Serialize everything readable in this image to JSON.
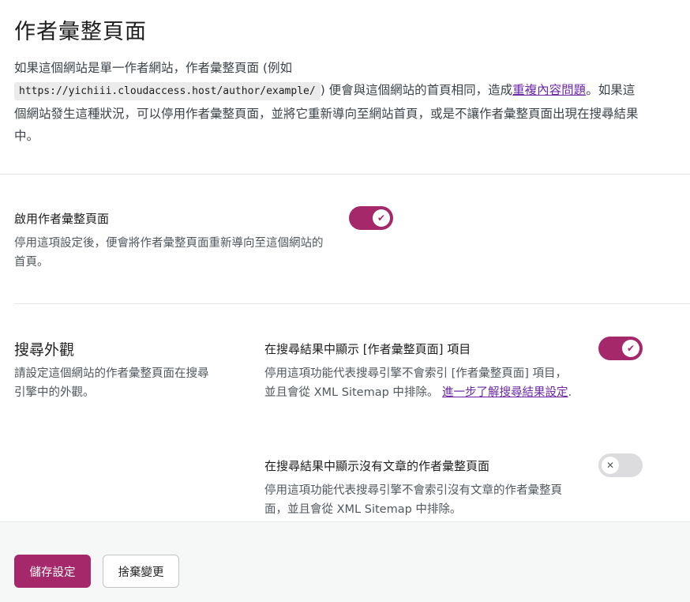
{
  "page": {
    "title": "作者彙整頁面"
  },
  "intro": {
    "text_before_code": "如果這個網站是單一作者網站，作者彙整頁面 (例如",
    "code": "https://yichiii.cloudaccess.host/author/example/",
    "text_after_code": ") 便會與這個網站的首頁相同，造成",
    "link": "重複內容問題",
    "text_after_link": "。如果這個網站發生這種狀況，可以停用作者彙整頁面，並將它重新導向至網站首頁，或是不讓作者彙整頁面出現在搜尋結果中。"
  },
  "enable_archive": {
    "label": "啟用作者彙整頁面",
    "description": "停用這項設定後，便會將作者彙整頁面重新導向至這個網站的首頁。",
    "toggle_state": "on",
    "toggle_glyph": "✔"
  },
  "search_appearance": {
    "title": "搜尋外觀",
    "description": "請設定這個網站的作者彙整頁面在搜尋引擎中的外觀。",
    "settings": [
      {
        "label": "在搜尋結果中顯示 [作者彙整頁面] 項目",
        "description": "停用這項功能代表搜尋引擎不會索引 [作者彙整頁面] 項目，並且會從 XML Sitemap 中排除。",
        "link": "進一步了解搜尋結果設定",
        "suffix": ".",
        "toggle_state": "on",
        "toggle_glyph": "✔"
      },
      {
        "label": "在搜尋結果中顯示沒有文章的作者彙整頁面",
        "description": "停用這項功能代表搜尋引擎不會索引沒有文章的作者彙整頁面，並且會從 XML Sitemap 中排除。",
        "toggle_state": "off",
        "toggle_glyph": "✕"
      }
    ]
  },
  "footer": {
    "save_label": "儲存設定",
    "discard_label": "捨棄變更"
  },
  "colors": {
    "accent": "#a4286a",
    "link": "#6d28a8",
    "toggle_off": "#dcdcde"
  }
}
